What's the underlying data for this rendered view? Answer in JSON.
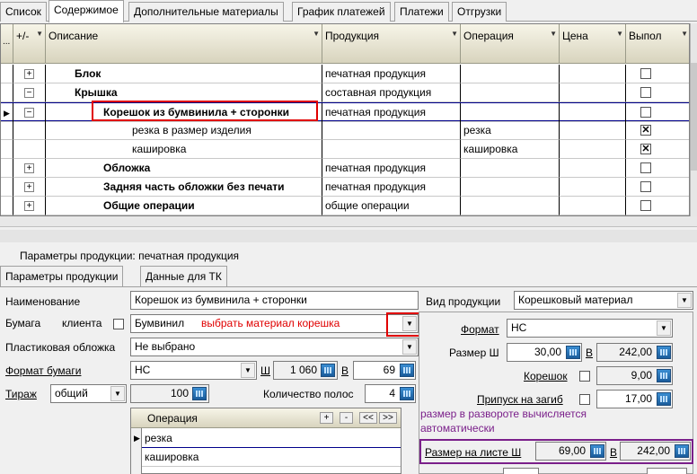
{
  "tabs": [
    "Список",
    "Содержимое",
    "Дополнительные материалы",
    "График платежей",
    "Платежи",
    "Отгрузки"
  ],
  "grid": {
    "headers": {
      "expand": "+/-",
      "description": "Описание",
      "product": "Продукция",
      "operation": "Операция",
      "price": "Цена",
      "done": "Выпол"
    },
    "rows": [
      {
        "sign": "+",
        "description": "Блок",
        "product": "печатная продукция",
        "operation": "",
        "done": false
      },
      {
        "sign": "−",
        "description": "Крышка",
        "product": "составная продукция",
        "operation": "",
        "done": false
      },
      {
        "sign": "−",
        "description": "Корешок из бумвинила + сторонки",
        "product": "печатная продукция",
        "operation": "",
        "done": false
      },
      {
        "sign": "",
        "description": "резка в размер изделия",
        "product": "",
        "operation": "резка",
        "done": true
      },
      {
        "sign": "",
        "description": "кашировка",
        "product": "",
        "operation": "кашировка",
        "done": true
      },
      {
        "sign": "+",
        "description": "Обложка",
        "product": "печатная продукция",
        "operation": "",
        "done": false
      },
      {
        "sign": "+",
        "description": "Задняя часть обложки без печати",
        "product": "печатная продукция",
        "operation": "",
        "done": false
      },
      {
        "sign": "+",
        "description": "Общие операции",
        "product": "общие операции",
        "operation": "",
        "done": false
      }
    ]
  },
  "params_header": "Параметры продукции: печатная продукция",
  "subtabs": [
    "Параметры продукции",
    "Данные для ТК"
  ],
  "form": {
    "name_label": "Наименование",
    "name_value": "Корешок из бумвинила + сторонки",
    "paper_label": "Бумага",
    "client_label": "клиента",
    "paper_value": "Бумвинил",
    "paper_hint": "выбрать материал корешка",
    "plastic_label": "Пластиковая обложка",
    "plastic_value": "Не выбрано",
    "format_label": "Формат бумаги",
    "format_value": "НС",
    "w_label": "Ш",
    "w_value": "1 060",
    "h_label": "В",
    "h_value": "69",
    "run_label": "Тираж",
    "run_type": "общий",
    "run_value": "100",
    "pages_label": "Количество полос",
    "pages_value": "4"
  },
  "ops": {
    "header": "Операция",
    "buttons": [
      "+",
      "-",
      "<<",
      ">>"
    ],
    "rows": [
      "резка",
      "кашировка"
    ]
  },
  "right": {
    "product_type_label": "Вид продукции",
    "product_type_value": "Корешковый материал",
    "format_label": "Формат",
    "format_value": "НС",
    "size_w_label": "Размер Ш",
    "size_w_value": "30,00",
    "size_h_label": "В",
    "size_h_value": "242,00",
    "spine_label": "Корешок",
    "spine_value": "9,00",
    "fold_label": "Припуск на загиб",
    "fold_value": "17,00",
    "auto_note": "размер в развороте вычисляется автоматически",
    "sheet_w_label": "Размер на листе Ш",
    "sheet_w_value": "69,00",
    "sheet_h_label": "В",
    "sheet_h_value": "242,00"
  },
  "colors": {
    "annotation_red": "#e00000",
    "annotation_purple": "#7a1f8a",
    "selection_line": "#00008b"
  }
}
